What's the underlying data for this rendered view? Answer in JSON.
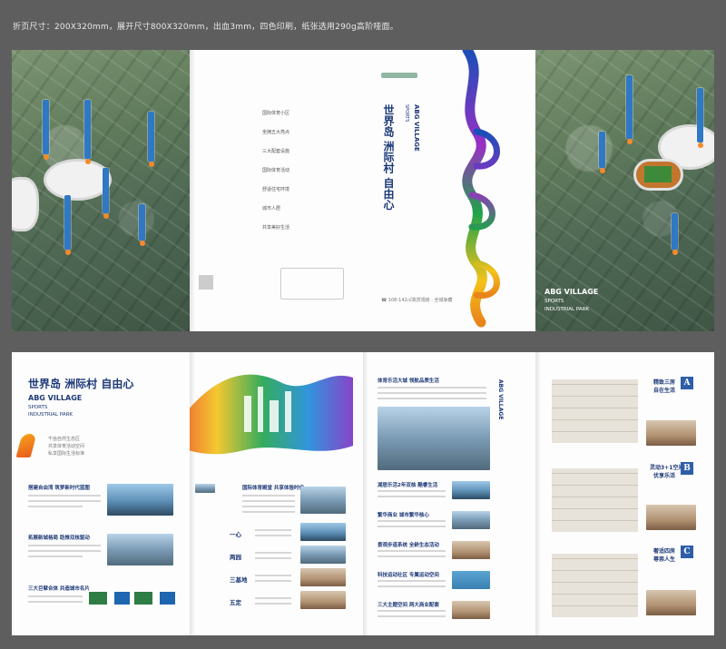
{
  "spec_text": "折页尺寸：200X320mm，展开尺寸800X320mm，出血3mm，四色印刷，纸张选用290g高阶哑面。",
  "cover": {
    "title_line1": "世界岛 洲际村 自由心",
    "brand": "ABG VILLAGE",
    "brand_sub1": "SPORTS",
    "brand_sub2": "INDUSTRIAL PARK",
    "brand_sub3": "INDUSTRIAL PARK",
    "contact": "☎ 108-142㎡高赏观房 · 全城争藏",
    "menu": [
      "国际体育小区",
      "坐拥五大亮点",
      "三大配套设施",
      "国际体育活动",
      "舒适住宅环境",
      "城市人居",
      "共享美好生活"
    ]
  },
  "inner": {
    "title": "世界岛 洲际村 自由心",
    "brand": "ABG VILLAGE",
    "brand_sub1": "SPORTS",
    "brand_sub2": "INDUSTRIAL PARK",
    "intro": [
      "千亩自然生态区",
      "共享体育活动空间",
      "私享国际生活标准"
    ],
    "sections": [
      {
        "title": "搭建自由湾 筑梦新时代蓝图"
      },
      {
        "title": "拓展新城格局 助推双核驱动"
      },
      {
        "title": "三大巨擘合体 共造城市名片"
      }
    ],
    "mid_title": "国际体育殿堂 共享体验时代",
    "mid_rows": [
      "一心",
      "两园",
      "三基地",
      "五定"
    ],
    "right_title": "体育乐活大城 领航品质生活",
    "right_rows": [
      "湖居乐活2年双核 酷睿生活",
      "繁华商业 城市繁华核心",
      "景观步道系统 全龄生态活动",
      "科技运动社区 专属运动空间",
      "三大主题空间 两大商业配套"
    ],
    "units": [
      {
        "letter": "A",
        "name": "精致三房",
        "desc": "自在生活"
      },
      {
        "letter": "B",
        "name": "灵动3+1空间",
        "desc": "优享乐活"
      },
      {
        "letter": "C",
        "name": "奢适四房",
        "desc": "尊崇人生"
      }
    ]
  }
}
